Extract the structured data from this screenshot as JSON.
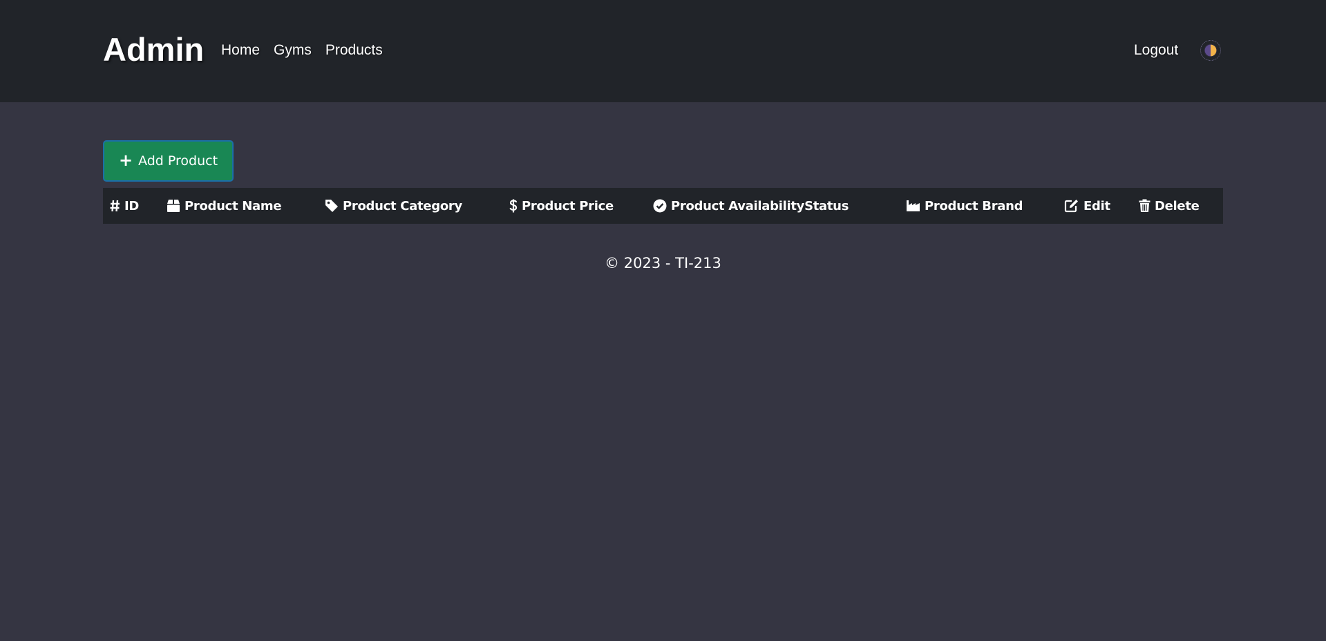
{
  "navbar": {
    "brand": "Admin",
    "links": [
      "Home",
      "Gyms",
      "Products"
    ],
    "logout_label": "Logout",
    "theme_toggle_icon": "half-moon-contrast-icon"
  },
  "toolbar": {
    "add_label": "Add Product",
    "add_icon": "plus-icon"
  },
  "table": {
    "columns": [
      {
        "label": "ID",
        "icon": "hash-icon"
      },
      {
        "label": "Product Name",
        "icon": "box-icon"
      },
      {
        "label": "Product Category",
        "icon": "tag-icon"
      },
      {
        "label": "Product Price",
        "icon": "dollar-icon"
      },
      {
        "label": "Product AvailabilityStatus",
        "icon": "check-circle-icon"
      },
      {
        "label": "Product Brand",
        "icon": "industry-icon"
      },
      {
        "label": "Edit",
        "icon": "edit-icon"
      },
      {
        "label": "Delete",
        "icon": "trash-icon"
      }
    ],
    "rows": []
  },
  "footer": {
    "text": "© 2023 - TI-213"
  },
  "colors": {
    "page_bg": "#353542",
    "navbar_bg": "#212429",
    "add_button_bg": "#198754",
    "add_button_border": "#1b6fa8",
    "table_head_bg": "#212429",
    "toggle_left": "#5b4a8a",
    "toggle_right": "#f2b34a"
  }
}
